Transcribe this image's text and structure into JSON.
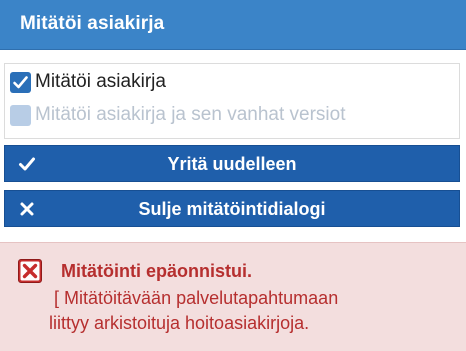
{
  "dialog": {
    "title": "Mitätöi asiakirja"
  },
  "options": [
    {
      "label": "Mitätöi asiakirja",
      "checked": true,
      "enabled": true
    },
    {
      "label": "Mitätöi asiakirja ja sen vanhat versiot",
      "checked": false,
      "enabled": false
    }
  ],
  "buttons": {
    "retry_label": "Yritä uudelleen",
    "close_label": "Sulje mitätöintidialogi"
  },
  "error": {
    "heading": "Mitätöinti epäonnistui.",
    "message": " [ Mitätöitävään palvelutapahtumaan\nliittyy arkistoituja hoitoasiakirjoja."
  },
  "colors": {
    "titlebar": "#3b84c8",
    "button": "#1f5fab",
    "error_bg": "#f3dede",
    "error_text": "#b62f2f"
  },
  "icons": {
    "retry": "check-icon",
    "close": "x-icon",
    "error": "error-x-icon"
  }
}
